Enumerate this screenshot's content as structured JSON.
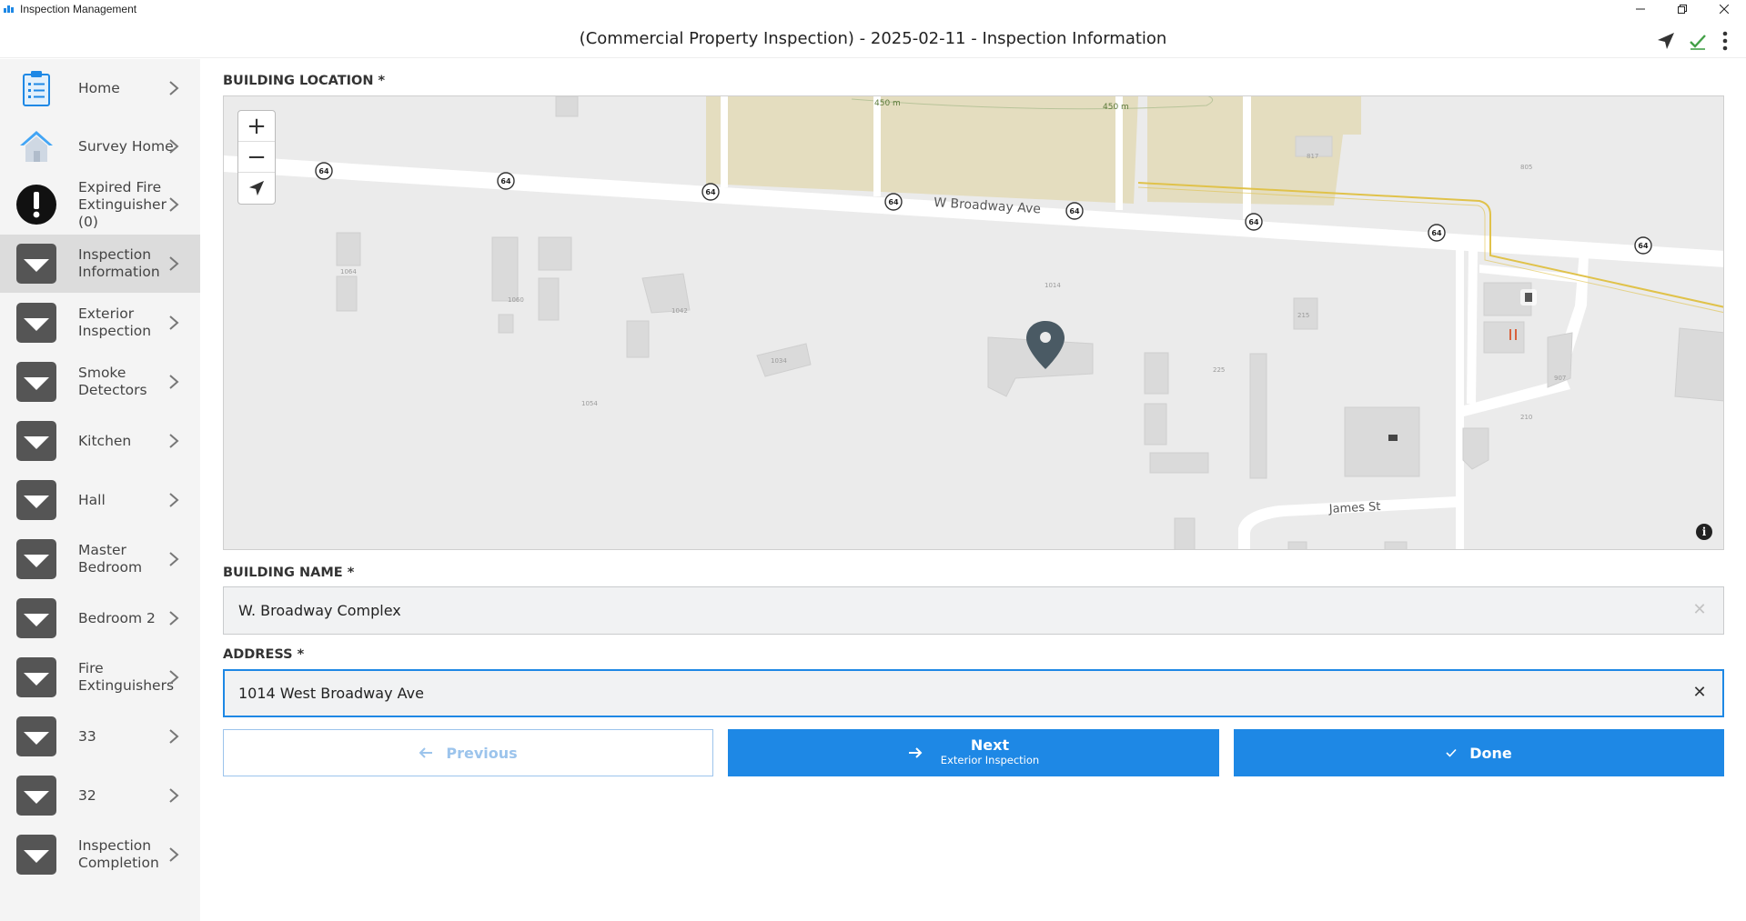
{
  "window": {
    "app_title": "Inspection Management"
  },
  "header": {
    "title": "(Commercial Property Inspection) - 2025-02-11 - Inspection Information"
  },
  "sidebar": {
    "items": [
      {
        "label": "Home"
      },
      {
        "label": "Survey Home"
      },
      {
        "label": "Expired Fire Extinguisher (0)"
      },
      {
        "label": "Inspection Information"
      },
      {
        "label": "Exterior Inspection"
      },
      {
        "label": "Smoke Detectors"
      },
      {
        "label": "Kitchen"
      },
      {
        "label": "Hall"
      },
      {
        "label": "Master Bedroom"
      },
      {
        "label": "Bedroom 2"
      },
      {
        "label": "Fire Extinguishers"
      },
      {
        "label": "33"
      },
      {
        "label": "32"
      },
      {
        "label": "Inspection Completion"
      }
    ]
  },
  "form": {
    "location_label": "BUILDING LOCATION *",
    "building_name_label": "BUILDING NAME *",
    "building_name_value": "W. Broadway Complex",
    "address_label": "ADDRESS *",
    "address_value": "1014 West Broadway Ave"
  },
  "map": {
    "zoom_in": "+",
    "zoom_out": "−",
    "info": "i",
    "streets": {
      "main": "W Broadway Ave",
      "side": "James St"
    },
    "route_shield": "64",
    "contour_labels": [
      "450 m",
      "450 m"
    ],
    "parcel_labels": [
      "1064",
      "1060",
      "1042",
      "1034",
      "1014",
      "1054",
      "225",
      "215",
      "817",
      "805",
      "907",
      "210"
    ]
  },
  "buttons": {
    "previous": "Previous",
    "next": "Next",
    "next_sub": "Exterior Inspection",
    "done": "Done"
  },
  "colors": {
    "accent": "#1e88e5",
    "sidebar_bg": "#f4f4f4",
    "active_item": "#dcdcdc",
    "check_green": "#43a047"
  }
}
